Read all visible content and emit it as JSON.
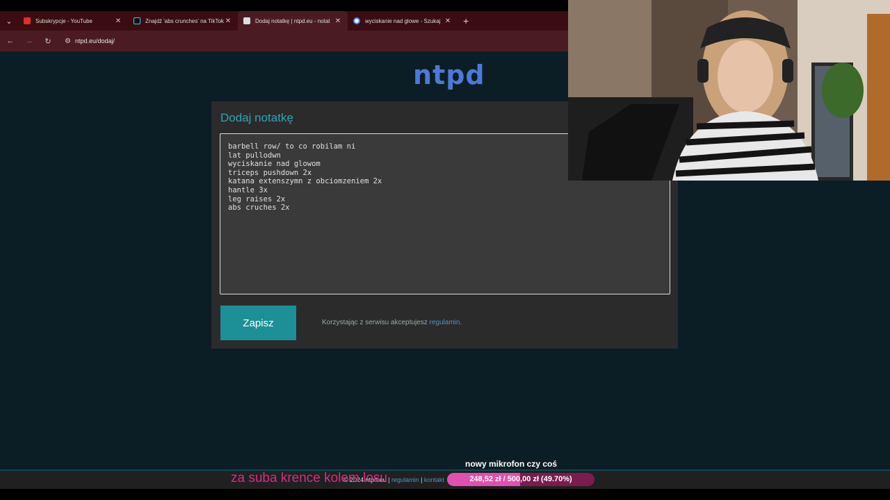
{
  "tabs": [
    {
      "title": "Subskrypcje - YouTube",
      "favicon": "youtube-icon",
      "color": "#e52d27"
    },
    {
      "title": "Znajdź 'abs crunches' na TikTok",
      "favicon": "tiktok-icon",
      "color": "#222222"
    },
    {
      "title": "Dodaj notatkę | ntpd.eu - notat",
      "favicon": "note-icon",
      "color": "#dddddd"
    },
    {
      "title": "wyciskanie nad glowe - Szukaj",
      "favicon": "google-icon",
      "color": "#4285f4"
    }
  ],
  "address": {
    "url": "ntpd.eu/dodaj/"
  },
  "site": {
    "logo": "ntpd"
  },
  "card": {
    "title": "Dodaj notatkę"
  },
  "note_lines": [
    "barbell row/ to co robilam ni",
    "lat pullodwn",
    "wyciskanie nad glowom",
    "triceps pushdown 2x",
    "katana extenszymn z obciomzeniem 2x",
    "hantle 3x",
    "leg raises 2x",
    "abs cruches 2x"
  ],
  "save_button": "Zapisz",
  "terms": {
    "text": "Korzystając z serwisu akceptujesz ",
    "link": "regulamin."
  },
  "footer": {
    "copyright": "© 2024 ntpd.eu | ",
    "link1": "regulamin",
    "sep": " | ",
    "link2": "kontakt"
  },
  "overlay": {
    "left_text": "za suba krence kolem losu"
  },
  "goal": {
    "title": "nowy mikrofon czy coś",
    "label": "248,52 zł / 500,00 zł (49.70%)",
    "fraction": 0.497
  },
  "colors": {
    "accent": "#1d8f97",
    "logo": "#4d7ad6",
    "goal": "#e34fb0"
  }
}
